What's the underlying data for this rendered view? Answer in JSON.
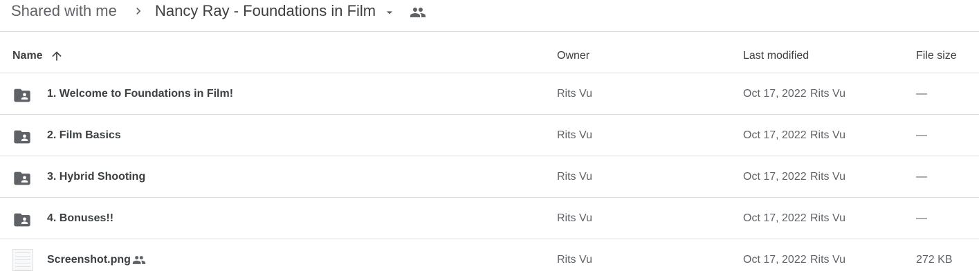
{
  "breadcrumb": {
    "root": "Shared with me",
    "current": "Nancy Ray - Foundations in Film"
  },
  "columns": {
    "name": "Name",
    "owner": "Owner",
    "last_modified": "Last modified",
    "file_size": "File size"
  },
  "rows": [
    {
      "type": "shared-folder",
      "icon": "shared-folder-icon",
      "name": "1. Welcome to Foundations in Film!",
      "owner": "Rits Vu",
      "modified_date": "Oct 17, 2022",
      "modified_by": "Rits Vu",
      "size": "—"
    },
    {
      "type": "shared-folder",
      "icon": "shared-folder-icon",
      "name": "2. Film Basics",
      "owner": "Rits Vu",
      "modified_date": "Oct 17, 2022",
      "modified_by": "Rits Vu",
      "size": "—"
    },
    {
      "type": "shared-folder",
      "icon": "shared-folder-icon",
      "name": "3. Hybrid Shooting",
      "owner": "Rits Vu",
      "modified_date": "Oct 17, 2022",
      "modified_by": "Rits Vu",
      "size": "—"
    },
    {
      "type": "shared-folder",
      "icon": "shared-folder-icon",
      "name": "4. Bonuses!!",
      "owner": "Rits Vu",
      "modified_date": "Oct 17, 2022",
      "modified_by": "Rits Vu",
      "size": "—"
    },
    {
      "type": "image",
      "icon": "image-thumbnail",
      "name": "Screenshot.png",
      "owner": "Rits Vu",
      "modified_date": "Oct 17, 2022",
      "modified_by": "Rits Vu",
      "size": "272 KB"
    }
  ],
  "colors": {
    "text_primary": "#3c4043",
    "text_secondary": "#5f6368",
    "divider": "#dadce0",
    "icon": "#5f6368"
  }
}
